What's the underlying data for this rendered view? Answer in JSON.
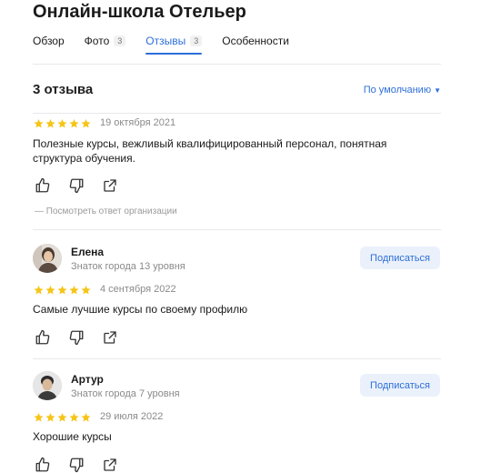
{
  "title": "Онлайн-школа Отельер",
  "tabs": [
    {
      "label": "Обзор",
      "count": ""
    },
    {
      "label": "Фото",
      "count": "3"
    },
    {
      "label": "Отзывы",
      "count": "3"
    },
    {
      "label": "Особенности",
      "count": ""
    }
  ],
  "reviews_heading": "3 отзыва",
  "sort_label": "По умолчанию",
  "sort_caret": "▼",
  "star_color": "#f5c518",
  "accent_color": "#2d6fd8",
  "reviews": [
    {
      "rating": 5,
      "date": "19 октября 2021",
      "text": "Полезные курсы, вежливый квалифицированный персонал, понятная структура обучения.",
      "org_answer_link": "— Посмотреть ответ организации"
    },
    {
      "author": "Елена",
      "level": "Знаток города 13 уровня",
      "subscribe": "Подписаться",
      "rating": 5,
      "date": "4 сентября 2022",
      "text": "Самые лучшие курсы по своему профилю"
    },
    {
      "author": "Артур",
      "level": "Знаток города 7 уровня",
      "subscribe": "Подписаться",
      "rating": 5,
      "date": "29 июля 2022",
      "text": "Хорошие курсы"
    }
  ],
  "action_icons": [
    "like-icon",
    "dislike-icon",
    "share-icon"
  ]
}
